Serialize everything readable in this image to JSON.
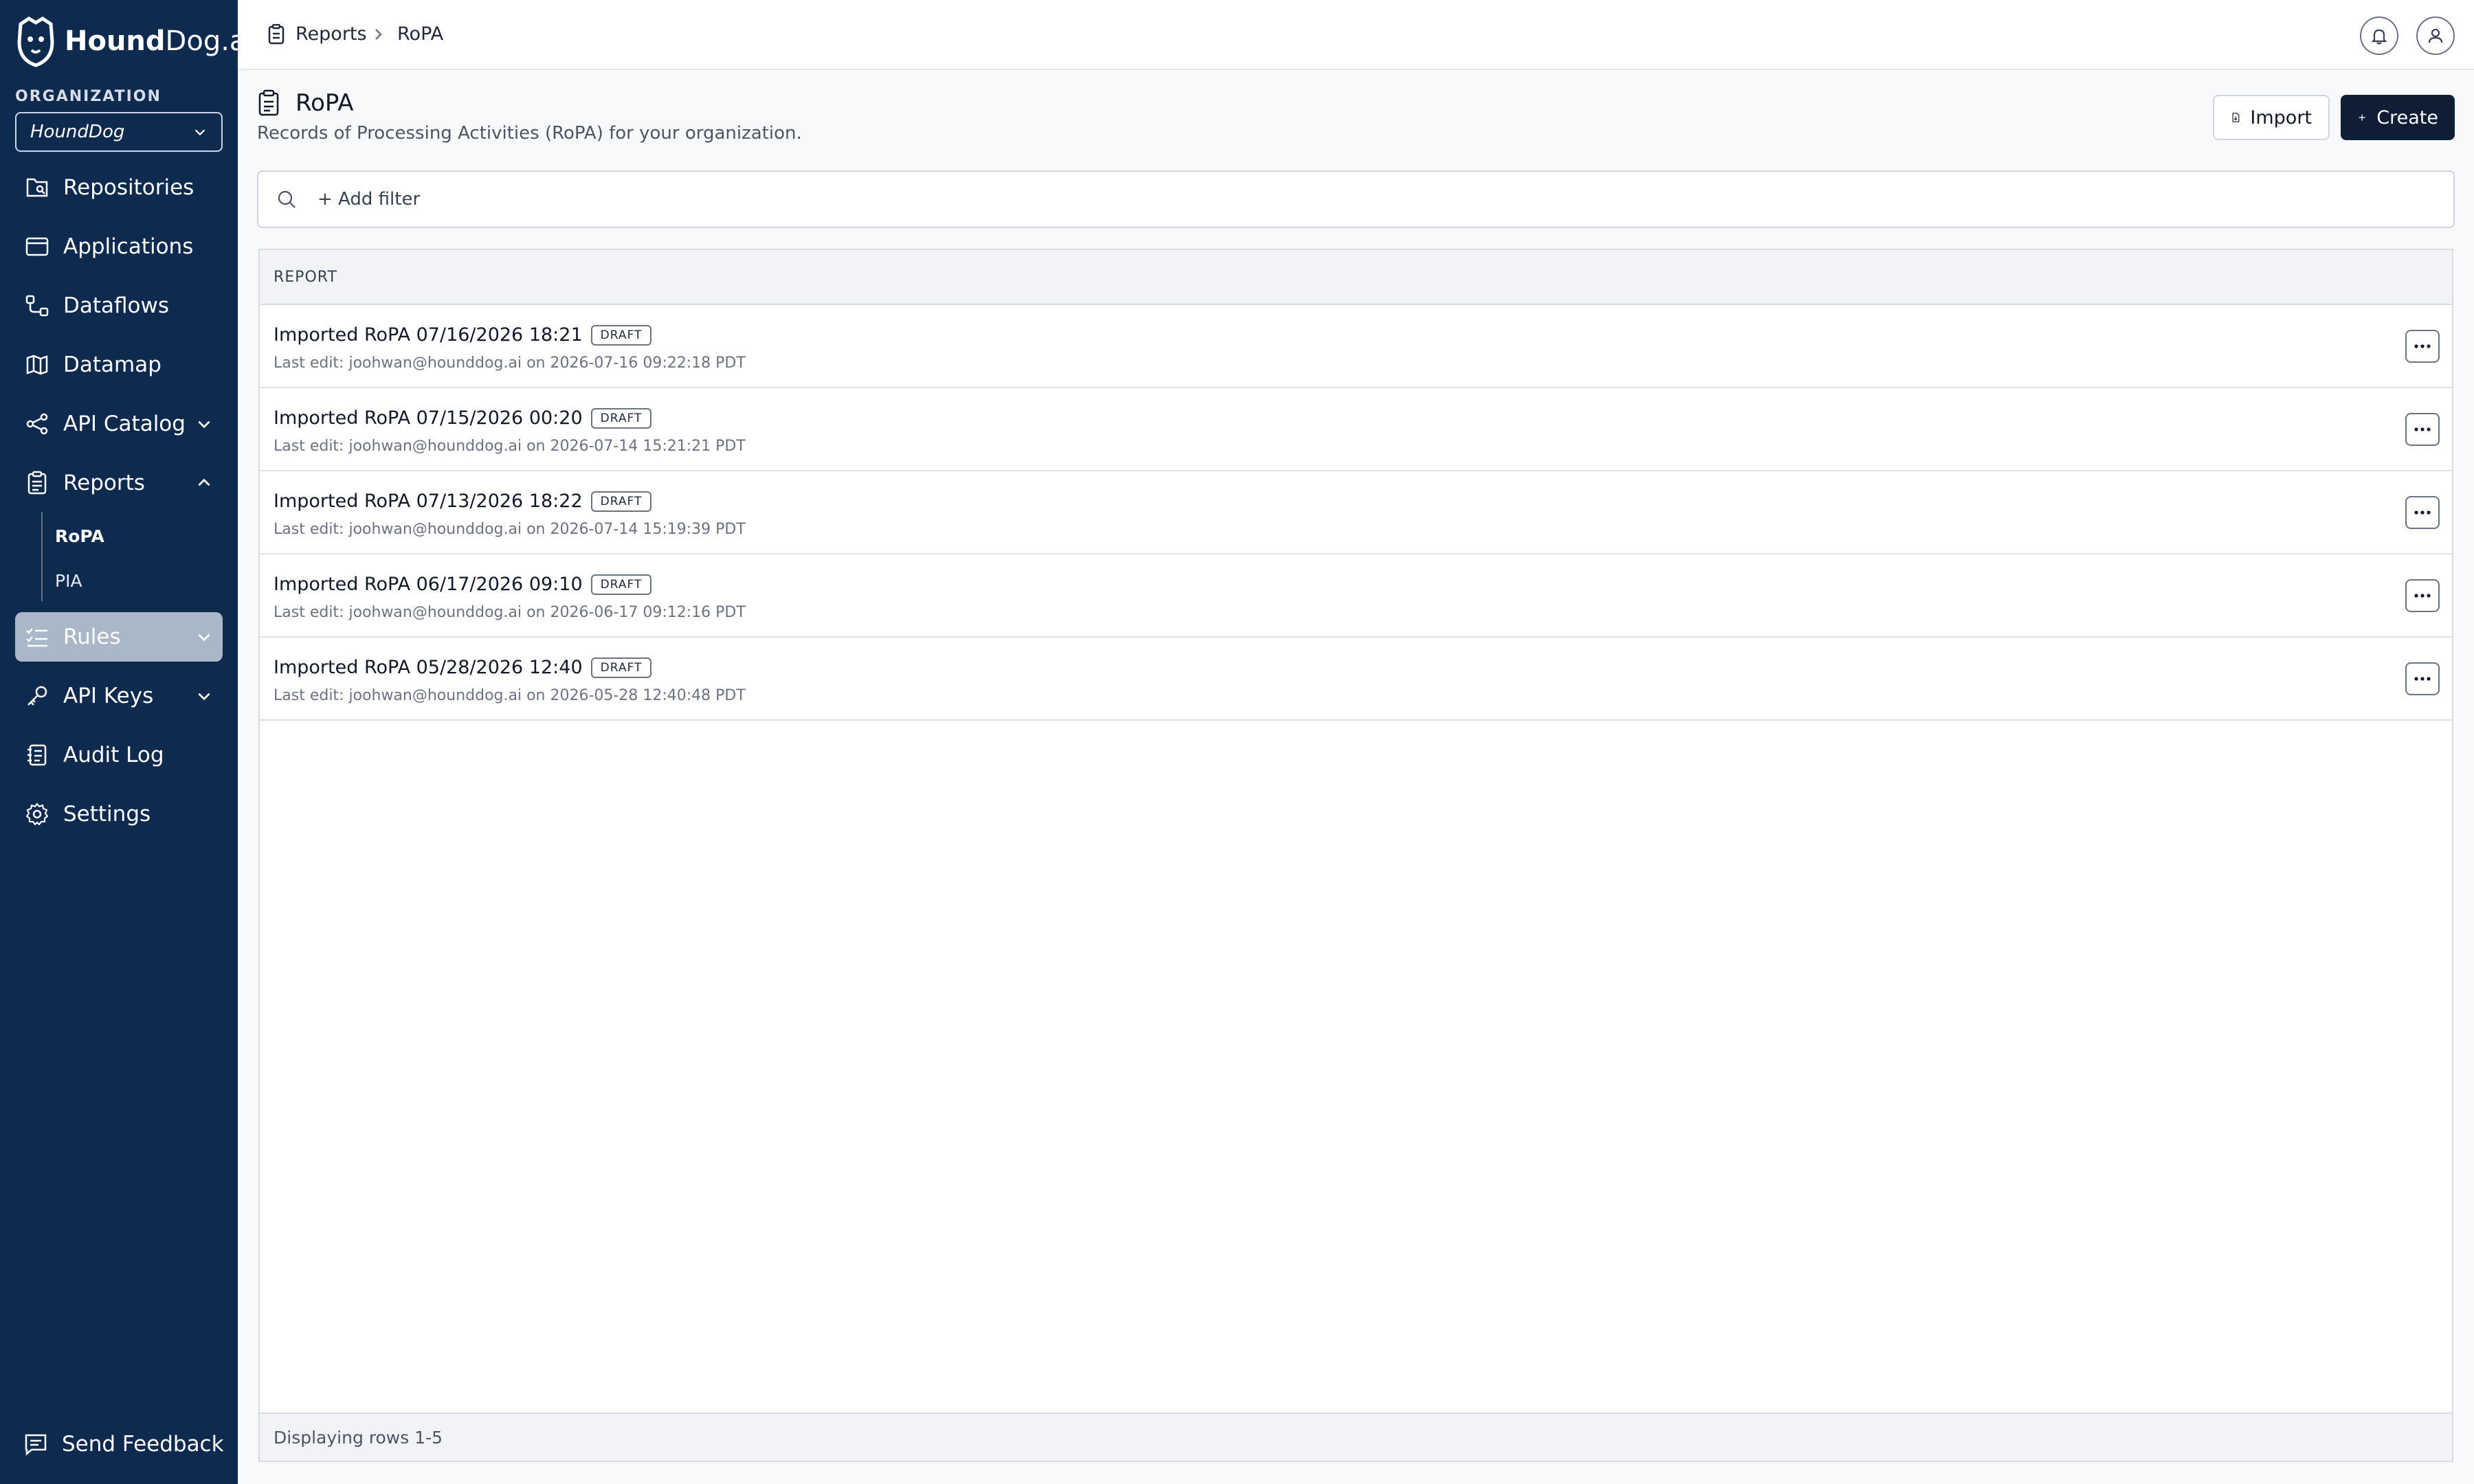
{
  "app": {
    "brand_bold": "Hound",
    "brand_rest": "Dog.ai"
  },
  "sidebar": {
    "org_label": "ORGANIZATION",
    "org_value": "HoundDog",
    "items": [
      {
        "label": "Repositories",
        "icon": "repositories-icon"
      },
      {
        "label": "Applications",
        "icon": "applications-icon"
      },
      {
        "label": "Dataflows",
        "icon": "dataflows-icon"
      },
      {
        "label": "Datamap",
        "icon": "datamap-icon"
      },
      {
        "label": "API Catalog",
        "icon": "api-catalog-icon"
      },
      {
        "label": "Reports",
        "icon": "reports-icon"
      },
      {
        "label": "Rules",
        "icon": "rules-icon"
      },
      {
        "label": "API Keys",
        "icon": "key-icon"
      },
      {
        "label": "Audit Log",
        "icon": "audit-log-icon"
      },
      {
        "label": "Settings",
        "icon": "gear-icon"
      }
    ],
    "sub_items": [
      {
        "label": "RoPA"
      },
      {
        "label": "PIA"
      }
    ],
    "feedback": "Send Feedback"
  },
  "breadcrumb": {
    "parent": "Reports",
    "current": "RoPA"
  },
  "header": {
    "title": "RoPA",
    "description": "Records of Processing Activities (RoPA) for your organization.",
    "import_label": "Import",
    "create_label": "Create"
  },
  "filter": {
    "placeholder": "+ Add filter"
  },
  "table": {
    "column": "REPORT",
    "rows": [
      {
        "title": "Imported RoPA 07/16/2026 18:21",
        "badge": "DRAFT",
        "meta": "Last edit: joohwan@hounddog.ai on 2026-07-16 09:22:18 PDT"
      },
      {
        "title": "Imported RoPA 07/15/2026 00:20",
        "badge": "DRAFT",
        "meta": "Last edit: joohwan@hounddog.ai on 2026-07-14 15:21:21 PDT"
      },
      {
        "title": "Imported RoPA 07/13/2026 18:22",
        "badge": "DRAFT",
        "meta": "Last edit: joohwan@hounddog.ai on 2026-07-14 15:19:39 PDT"
      },
      {
        "title": "Imported RoPA 06/17/2026 09:10",
        "badge": "DRAFT",
        "meta": "Last edit: joohwan@hounddog.ai on 2026-06-17 09:12:16 PDT"
      },
      {
        "title": "Imported RoPA 05/28/2026 12:40",
        "badge": "DRAFT",
        "meta": "Last edit: joohwan@hounddog.ai on 2026-05-28 12:40:48 PDT"
      }
    ],
    "footer": "Displaying rows 1-5"
  },
  "colors": {
    "sidebar_bg": "#0f2a4f",
    "primary_button": "#0f1e35",
    "active_nav": "#a9b7c9"
  }
}
